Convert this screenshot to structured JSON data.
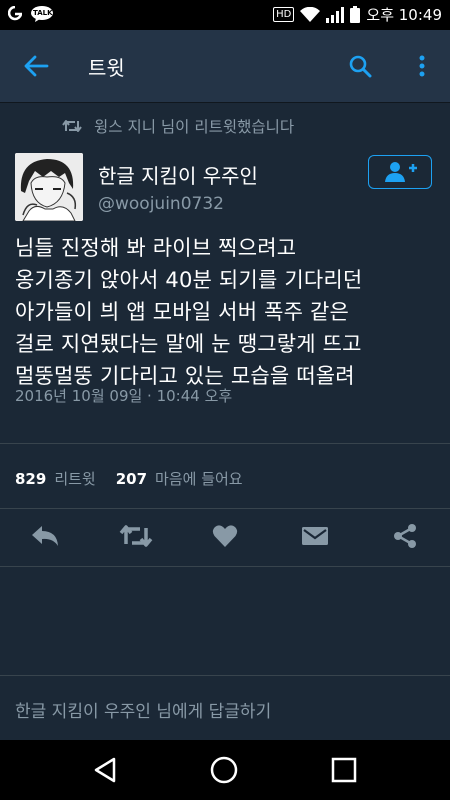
{
  "statusbar": {
    "time": "오후 10:49",
    "hd_badge": "HD",
    "talk_badge": "TALK"
  },
  "appbar": {
    "title": "트윗",
    "back_icon": "arrow-left-icon",
    "search_icon": "search-icon",
    "more_icon": "more-vertical-icon"
  },
  "retweet_context": {
    "text": "윙스 지니 님이 리트윗했습니다",
    "icon": "retweet-icon"
  },
  "tweet": {
    "author_name": "한글 지킴이 우주인",
    "author_handle": "@woojuin0732",
    "lines": [
      "님들 진정해 봐 라이브 찍으려고",
      "옹기종기 앉아서 40분 되기를 기다리던",
      "아가들이 븨 앱 모바일 서버 폭주 같은",
      "걸로 지연됐다는 말에 눈 땡그랗게 뜨고",
      "멀뚱멀뚱 기다리고 있는 모습을 떠올려"
    ],
    "timestamp": "2016년 10월 09일 · 10:44 오후"
  },
  "stats": {
    "retweets_count": "829",
    "retweets_label": "리트윗",
    "likes_count": "207",
    "likes_label": "마음에 들어요"
  },
  "reply_placeholder": "한글 지킴이 우주인 님에게 답글하기",
  "colors": {
    "background": "#1b2836",
    "appbar": "#243447",
    "accent": "#1da1f2",
    "secondary_text": "#8899a6"
  }
}
